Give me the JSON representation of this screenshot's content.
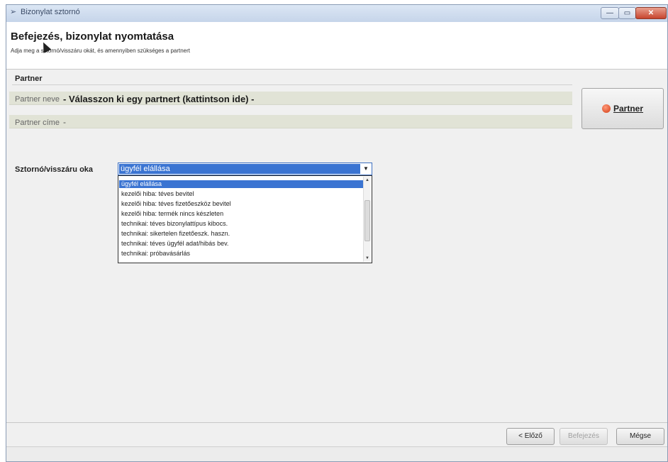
{
  "window": {
    "title": "Bizonylat sztornó",
    "minimize_glyph": "—",
    "maximize_glyph": "▭",
    "close_glyph": "✕"
  },
  "header": {
    "title": "Befejezés, bizonylat nyomtatása",
    "subtitle": "Adja meg a sztornó/visszáru okát, és amennyiben szükséges a partnert"
  },
  "partner": {
    "group_title": "Partner",
    "name_label": "Partner neve",
    "name_value": "- Válasszon ki egy partnert (kattintson ide) -",
    "address_label": "Partner címe",
    "address_value": "-",
    "button_label": "Partner",
    "button_icon": "partner-icon"
  },
  "reason": {
    "label": "Sztornó/visszáru oka",
    "selected": "ügyfél elállása",
    "options": [
      "ügyfél elállása",
      "kezelői hiba: téves bevitel",
      "kezelői hiba: téves fizetőeszköz bevitel",
      "kezelői hiba: termék nincs készleten",
      "technikai: téves bizonylattípus kibocs.",
      "technikai: sikertelen fizetőeszk. haszn.",
      "technikai: téves ügyfél adat/hibás bev.",
      "technikai: próbavásárlás"
    ],
    "arrow_glyph": "▼",
    "scroll_up_glyph": "▲",
    "scroll_down_glyph": "▼"
  },
  "footer": {
    "back_label": "< Előző",
    "finish_label": "Befejezés",
    "cancel_label": "Mégse"
  }
}
